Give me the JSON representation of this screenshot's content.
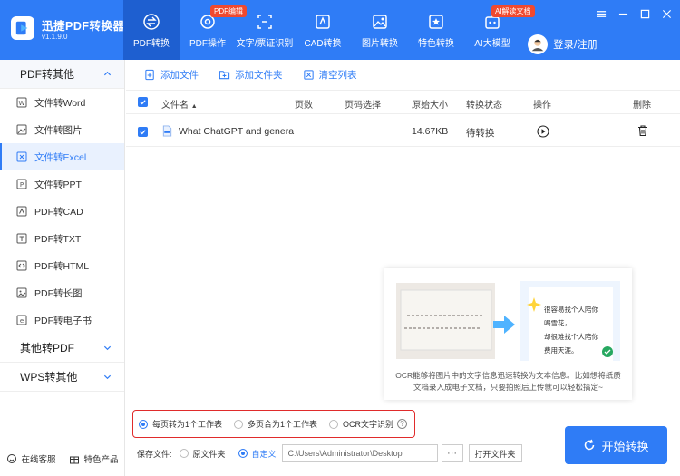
{
  "app": {
    "name": "迅捷PDF转换器",
    "version": "v1.1.9.0"
  },
  "nav": [
    {
      "label": "PDF转换",
      "icon": "swap-circle-icon",
      "badge": ""
    },
    {
      "label": "PDF操作",
      "icon": "gear-icon",
      "badge": "PDF编辑"
    },
    {
      "label": "文字/票证识别",
      "icon": "scan-icon",
      "badge": ""
    },
    {
      "label": "CAD转换",
      "icon": "cad-icon",
      "badge": ""
    },
    {
      "label": "图片转换",
      "icon": "image-icon",
      "badge": ""
    },
    {
      "label": "特色转换",
      "icon": "star-icon",
      "badge": ""
    },
    {
      "label": "AI大模型",
      "icon": "ai-robot-icon",
      "badge": "AI解读文档"
    }
  ],
  "login": "登录/注册",
  "sidebar": {
    "groups": [
      {
        "label": "PDF转其他",
        "open": true
      },
      {
        "label": "其他转PDF",
        "open": false
      },
      {
        "label": "WPS转其他",
        "open": false
      }
    ],
    "items": [
      {
        "label": "文件转Word",
        "icon": "word-icon"
      },
      {
        "label": "文件转图片",
        "icon": "image-icon"
      },
      {
        "label": "文件转Excel",
        "icon": "excel-icon"
      },
      {
        "label": "文件转PPT",
        "icon": "ppt-icon"
      },
      {
        "label": "PDF转CAD",
        "icon": "cad-icon"
      },
      {
        "label": "PDF转TXT",
        "icon": "txt-icon"
      },
      {
        "label": "PDF转HTML",
        "icon": "html-icon"
      },
      {
        "label": "PDF转长图",
        "icon": "long-image-icon"
      },
      {
        "label": "PDF转电子书",
        "icon": "ebook-icon"
      }
    ],
    "active_item": 2,
    "service": "在线客服",
    "features": "特色产品"
  },
  "toolbar": {
    "add_file": "添加文件",
    "add_folder": "添加文件夹",
    "clear": "清空列表"
  },
  "table": {
    "headers": {
      "filename": "文件名",
      "pages": "页数",
      "page_select": "页码选择",
      "size": "原始大小",
      "status": "转换状态",
      "action": "操作",
      "delete": "删除"
    },
    "rows": [
      {
        "filename": "What ChatGPT and genera",
        "size": "14.67KB",
        "status": "待转换"
      }
    ]
  },
  "promo": {
    "line1": "OCR能够将图片中的文字信息迅速转换为文本信息。比如想将纸质",
    "line2": "文档录入成电子文档，只要拍照后上传就可以轻松搞定~",
    "card_text": [
      "很容易找个人陪你",
      "喝雪花，",
      "却很难找个人陪你",
      "费用天涯。"
    ]
  },
  "options": {
    "each_page": "每页转为1个工作表",
    "multi_page": "多页合为1个工作表",
    "ocr": "OCR文字识别",
    "selected": 0
  },
  "save": {
    "label": "保存文件:",
    "original": "原文件夹",
    "custom": "自定义",
    "path": "C:\\Users\\Administrator\\Desktop",
    "dots": "···",
    "open_folder": "打开文件夹"
  },
  "start_button": "开始转换",
  "colors": {
    "primary": "#2f7cf6",
    "active_nav": "#1e5fd0",
    "badge": "#f0492f",
    "highlight_border": "#e02b2b"
  }
}
